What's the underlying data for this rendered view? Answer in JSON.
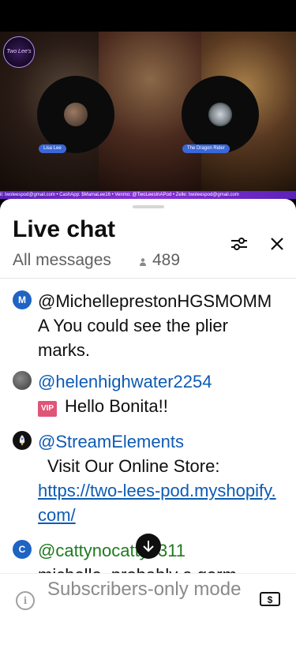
{
  "video": {
    "logo_text": "Two Lee's",
    "ticker": "il: twoleespod@gmail.com • CashApp: $MamaLee16 • Venmo: @TwoLeesInAPod • Zelle: twoleespod@gmail.com",
    "guests": [
      {
        "label": "Lisa Lee"
      },
      {
        "label": "The Dragon Rider"
      }
    ]
  },
  "chat": {
    "title": "Live chat",
    "filter": "All messages",
    "viewer_count": "489",
    "messages": [
      {
        "avatar_letter": "M",
        "avatar_color": "#1f63c4",
        "author": "@MichelleprestonHGSMOMMA",
        "text": "You could see the plier marks."
      },
      {
        "avatar_letter": "",
        "avatar_color": "#555555",
        "author": "@helenhighwater2254",
        "badge": "VIP",
        "text": "Hello Bonita!!"
      },
      {
        "avatar_letter": "",
        "avatar_color": "#111111",
        "author": "@StreamElements",
        "text": "Visit Our Online Store:",
        "link": "https://two-lees-pod.myshopify.com/"
      },
      {
        "avatar_letter": "C",
        "avatar_color": "#1f63c4",
        "author": "@cattynocatty3311",
        "text": "michelle, probably a germ"
      }
    ]
  },
  "input": {
    "placeholder": "Subscribers-only mode"
  },
  "icons": {
    "settings": "sliders-icon",
    "close": "close-icon",
    "viewers": "person-icon",
    "scroll": "arrow-down-icon",
    "info": "info-icon",
    "super_chat": "dollar-bill-icon"
  }
}
